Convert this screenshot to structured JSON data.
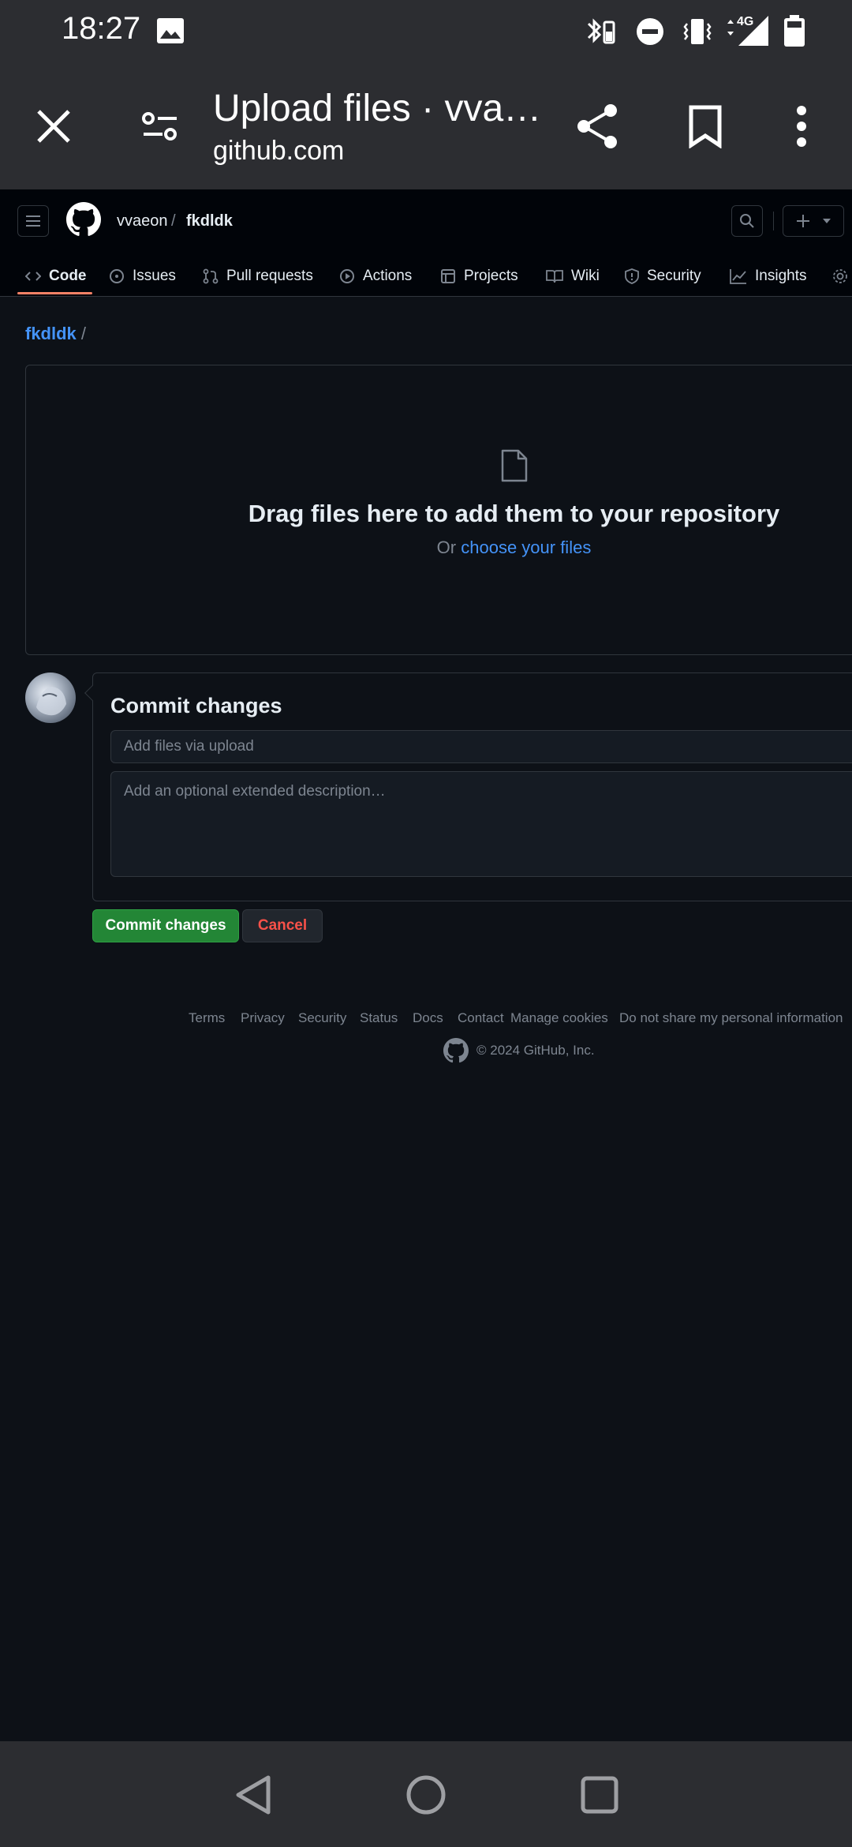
{
  "status_bar": {
    "time": "18:27",
    "network_label": "4G"
  },
  "browser": {
    "page_title": "Upload files · vvaeon/fkdldk",
    "domain": "github.com"
  },
  "repo_header": {
    "owner": "vvaeon",
    "separator": "/",
    "repo": "fkdldk"
  },
  "tabs": [
    {
      "label": "Code",
      "icon": "code-icon",
      "active": true
    },
    {
      "label": "Issues",
      "icon": "issue-opened-icon"
    },
    {
      "label": "Pull requests",
      "icon": "git-pull-request-icon"
    },
    {
      "label": "Actions",
      "icon": "play-icon"
    },
    {
      "label": "Projects",
      "icon": "table-icon"
    },
    {
      "label": "Wiki",
      "icon": "book-icon"
    },
    {
      "label": "Security",
      "icon": "shield-icon"
    },
    {
      "label": "Insights",
      "icon": "graph-icon"
    }
  ],
  "breadcrumb": {
    "repo_link": "fkdldk",
    "separator": "/"
  },
  "dropzone": {
    "heading": "Drag files here to add them to your repository",
    "prefix": "Or",
    "link": "choose your files"
  },
  "commit": {
    "title": "Commit changes",
    "summary_placeholder": "Add files via upload",
    "description_placeholder": "Add an optional extended description…",
    "commit_button": "Commit changes",
    "cancel_button": "Cancel"
  },
  "footer": {
    "links": [
      "Terms",
      "Privacy",
      "Security",
      "Status",
      "Docs",
      "Contact",
      "Manage cookies",
      "Do not share my personal information"
    ],
    "copyright": "© 2024 GitHub, Inc."
  },
  "colors": {
    "background": "#0d1117",
    "header": "#010409",
    "link": "#4493f8",
    "primary_button": "#238636",
    "danger_text": "#f85149",
    "tab_underline": "#f78166"
  }
}
